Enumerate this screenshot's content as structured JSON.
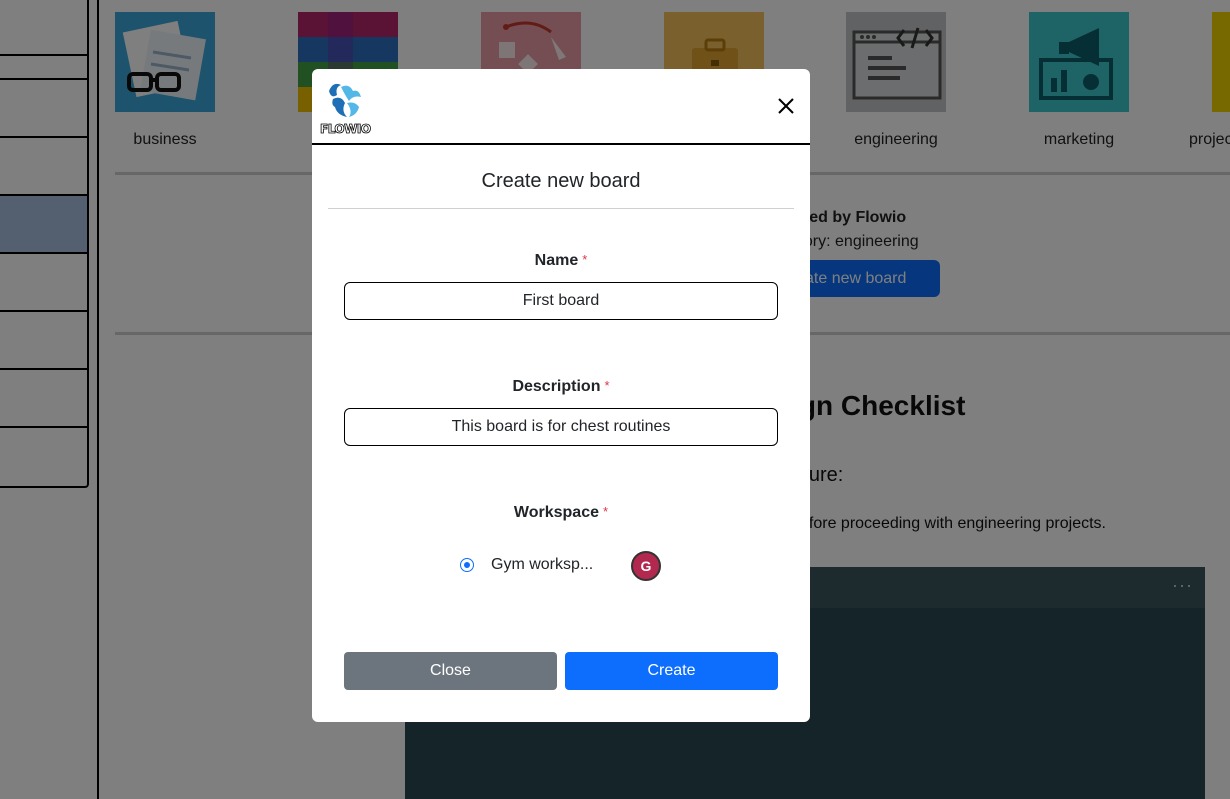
{
  "categories": [
    {
      "label": "business",
      "icon": "business-documents-icon",
      "color": "#3aa6d8"
    },
    {
      "label": "",
      "icon": "education-blocks-icon",
      "color": "#b5256a"
    },
    {
      "label": "",
      "icon": "design-tools-icon",
      "color": "#e89ca6"
    },
    {
      "label": "",
      "icon": "briefcase-icon",
      "color": "#f4c15a"
    },
    {
      "label": "engineering",
      "icon": "code-window-icon",
      "color": "#c3c4c8"
    },
    {
      "label": "marketing",
      "icon": "megaphone-icon",
      "color": "#3dc6cc"
    },
    {
      "label": "projec",
      "icon": "project-icon",
      "color": "#f0d000"
    }
  ],
  "template": {
    "created_by": "ated by Flowio",
    "category": "gory: engineering",
    "create_button": "ate new board"
  },
  "content": {
    "title": "esign Checklist",
    "subtitle": "structure:",
    "text": "met before proceeding with engineering projects."
  },
  "modal": {
    "logo_text": "FLOWIO",
    "title": "Create new board",
    "name": {
      "label": "Name",
      "value": "First board",
      "required": "*"
    },
    "description": {
      "label": "Description",
      "value": "This board is for chest routines",
      "required": "*"
    },
    "workspace": {
      "label": "Workspace",
      "required": "*",
      "option": "Gym worksp...",
      "avatar": "G",
      "selected": true
    },
    "close_button": "Close",
    "create_button": "Create"
  },
  "colors": {
    "primary": "#0d6efd",
    "secondary": "#6c757d",
    "required": "#dc3545",
    "avatar": "#b2284f"
  }
}
